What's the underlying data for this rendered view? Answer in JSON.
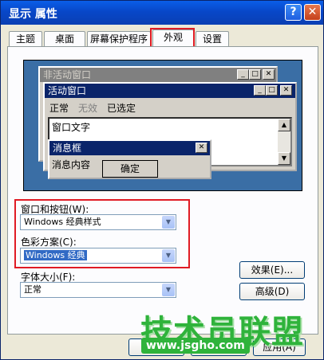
{
  "window": {
    "title": "显示 属性",
    "help_glyph": "?",
    "close_glyph": "✕"
  },
  "tabs": [
    {
      "label": "主题"
    },
    {
      "label": "桌面"
    },
    {
      "label": "屏幕保护程序"
    },
    {
      "label": "外观"
    },
    {
      "label": "设置"
    }
  ],
  "active_tab": "外观",
  "preview": {
    "inactive_window_title": "非活动窗口",
    "active_window_title": "活动窗口",
    "menu": {
      "normal": "正常",
      "disabled": "无效",
      "selected": "已选定"
    },
    "window_text": "窗口文字",
    "message_box": {
      "title": "消息框",
      "content": "消息内容",
      "ok_label": "确定"
    },
    "caption_glyphs": {
      "minimize": "_",
      "maximize": "□",
      "close": "✕"
    },
    "colors": {
      "desktop": "#3a6ea5",
      "active_caption": "#0a246a",
      "inactive_caption": "#808080",
      "face": "#d4d0c8"
    }
  },
  "fields": {
    "windows_buttons": {
      "label": "窗口和按钮(W):",
      "value": "Windows 经典样式"
    },
    "color_scheme": {
      "label": "色彩方案(C):",
      "value": "Windows 经典"
    },
    "font_size": {
      "label": "字体大小(F):",
      "value": "正常"
    }
  },
  "buttons": {
    "effects": "效果(E)...",
    "advanced": "高级(D)",
    "apply": "应用(A)"
  },
  "watermark": {
    "text": "技术员联盟",
    "url": "www.jsgho.com"
  },
  "highlight_color": "#e01b24"
}
